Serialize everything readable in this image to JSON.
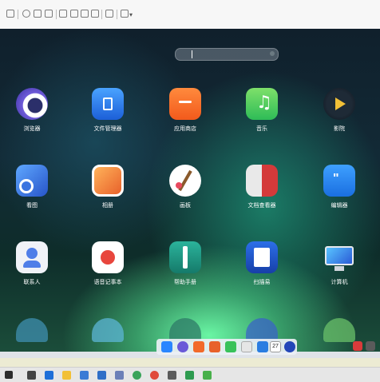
{
  "vm_toolbar": {
    "icons": [
      "settings-icon",
      "history-icon",
      "snapshot-icon",
      "network-icon",
      "view-icon",
      "window-icon",
      "fullscreen-icon",
      "shrink-icon",
      "console-icon",
      "expand-icon"
    ]
  },
  "launcher": {
    "search_placeholder": "",
    "apps": [
      {
        "label": "浏览器",
        "icon": "browser-icon"
      },
      {
        "label": "文件管理器",
        "icon": "file-manager-icon"
      },
      {
        "label": "应用商店",
        "icon": "app-store-icon"
      },
      {
        "label": "音乐",
        "icon": "music-icon"
      },
      {
        "label": "影院",
        "icon": "movie-icon"
      },
      {
        "label": "看图",
        "icon": "image-viewer-icon"
      },
      {
        "label": "相册",
        "icon": "album-icon"
      },
      {
        "label": "画板",
        "icon": "draw-icon"
      },
      {
        "label": "文档查看器",
        "icon": "document-viewer-icon"
      },
      {
        "label": "编辑器",
        "icon": "editor-icon"
      },
      {
        "label": "联系人",
        "icon": "contacts-icon"
      },
      {
        "label": "语音记事本",
        "icon": "voice-notes-icon"
      },
      {
        "label": "帮助手册",
        "icon": "help-manual-icon"
      },
      {
        "label": "扫描易",
        "icon": "scanner-icon"
      },
      {
        "label": "计算机",
        "icon": "computer-icon"
      }
    ]
  },
  "dock": {
    "calendar_day": "27"
  }
}
